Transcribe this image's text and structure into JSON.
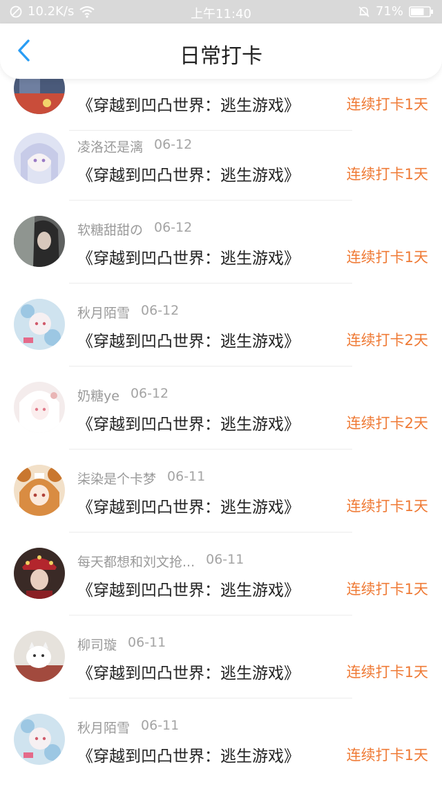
{
  "status_bar": {
    "network_speed": "10.2K/s",
    "time": "上午11:40",
    "battery_percent": "71%",
    "battery_level": 0.71
  },
  "header": {
    "back_icon": "chevron-left-icon",
    "title": "日常打卡"
  },
  "accent_color": "#ef7a35",
  "items": [
    {
      "username": "",
      "date": "",
      "game": "《穿越到凹凸世界：逃生游戏》",
      "streak": "连续打卡1天"
    },
    {
      "username": "凌洛还是漓",
      "date": "06-12",
      "game": "《穿越到凹凸世界：逃生游戏》",
      "streak": "连续打卡1天"
    },
    {
      "username": "软糖甜甜の",
      "date": "06-12",
      "game": "《穿越到凹凸世界：逃生游戏》",
      "streak": "连续打卡1天"
    },
    {
      "username": "秋月陌雪",
      "date": "06-12",
      "game": "《穿越到凹凸世界：逃生游戏》",
      "streak": "连续打卡2天"
    },
    {
      "username": "奶糖ye",
      "date": "06-12",
      "game": "《穿越到凹凸世界：逃生游戏》",
      "streak": "连续打卡2天"
    },
    {
      "username": "柒染是个卡梦",
      "date": "06-11",
      "game": "《穿越到凹凸世界：逃生游戏》",
      "streak": "连续打卡1天"
    },
    {
      "username": "每天都想和刘文抢...",
      "date": "06-11",
      "game": "《穿越到凹凸世界：逃生游戏》",
      "streak": "连续打卡1天"
    },
    {
      "username": "柳司璇",
      "date": "06-11",
      "game": "《穿越到凹凸世界：逃生游戏》",
      "streak": "连续打卡1天"
    },
    {
      "username": "秋月陌雪",
      "date": "06-11",
      "game": "《穿越到凹凸世界：逃生游戏》",
      "streak": "连续打卡1天"
    }
  ]
}
